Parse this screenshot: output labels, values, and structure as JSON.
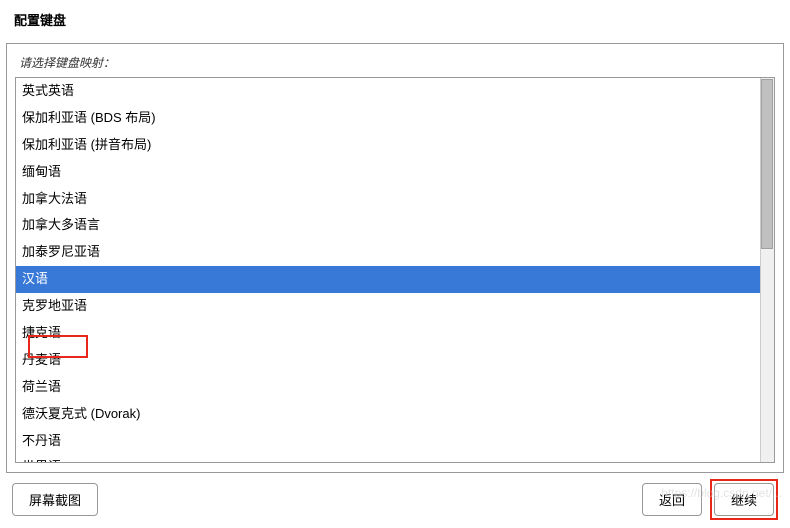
{
  "header": {
    "title": "配置键盘"
  },
  "prompt": "请选择键盘映射：",
  "list_items": [
    {
      "label": "英式英语",
      "selected": false
    },
    {
      "label": "保加利亚语 (BDS 布局)",
      "selected": false
    },
    {
      "label": "保加利亚语 (拼音布局)",
      "selected": false
    },
    {
      "label": "缅甸语",
      "selected": false
    },
    {
      "label": "加拿大法语",
      "selected": false
    },
    {
      "label": "加拿大多语言",
      "selected": false
    },
    {
      "label": "加泰罗尼亚语",
      "selected": false
    },
    {
      "label": "汉语",
      "selected": true
    },
    {
      "label": "克罗地亚语",
      "selected": false
    },
    {
      "label": "捷克语",
      "selected": false
    },
    {
      "label": "丹麦语",
      "selected": false
    },
    {
      "label": "荷兰语",
      "selected": false
    },
    {
      "label": "德沃夏克式 (Dvorak)",
      "selected": false
    },
    {
      "label": "不丹语",
      "selected": false
    },
    {
      "label": "世界语",
      "selected": false
    }
  ],
  "footer": {
    "screenshot_btn": "屏幕截图",
    "back_btn": "返回",
    "continue_btn": "继续"
  },
  "watermark": "https://blog.csdn.net/..."
}
